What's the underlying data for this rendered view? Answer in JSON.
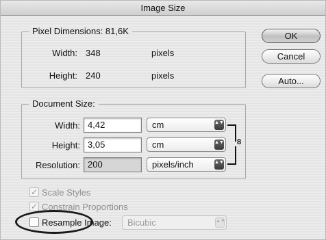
{
  "window": {
    "title": "Image Size"
  },
  "pixel_dimensions": {
    "legend": "Pixel Dimensions: 81,6K",
    "width_label": "Width:",
    "width_value": "348",
    "width_unit": "pixels",
    "height_label": "Height:",
    "height_value": "240",
    "height_unit": "pixels"
  },
  "document_size": {
    "legend": "Document Size:",
    "width_label": "Width:",
    "width_value": "4,42",
    "width_unit": "cm",
    "height_label": "Height:",
    "height_value": "3,05",
    "height_unit": "cm",
    "resolution_label": "Resolution:",
    "resolution_value": "200",
    "resolution_unit": "pixels/inch"
  },
  "buttons": {
    "ok": "OK",
    "cancel": "Cancel",
    "auto": "Auto..."
  },
  "options": {
    "scale_styles": "Scale Styles",
    "constrain": "Constrain Proportions",
    "resample": "Resample Image:",
    "resample_method": "Bicubic"
  },
  "glyphs": {
    "check": "✓",
    "arrows": "▲▼",
    "link": "8"
  }
}
